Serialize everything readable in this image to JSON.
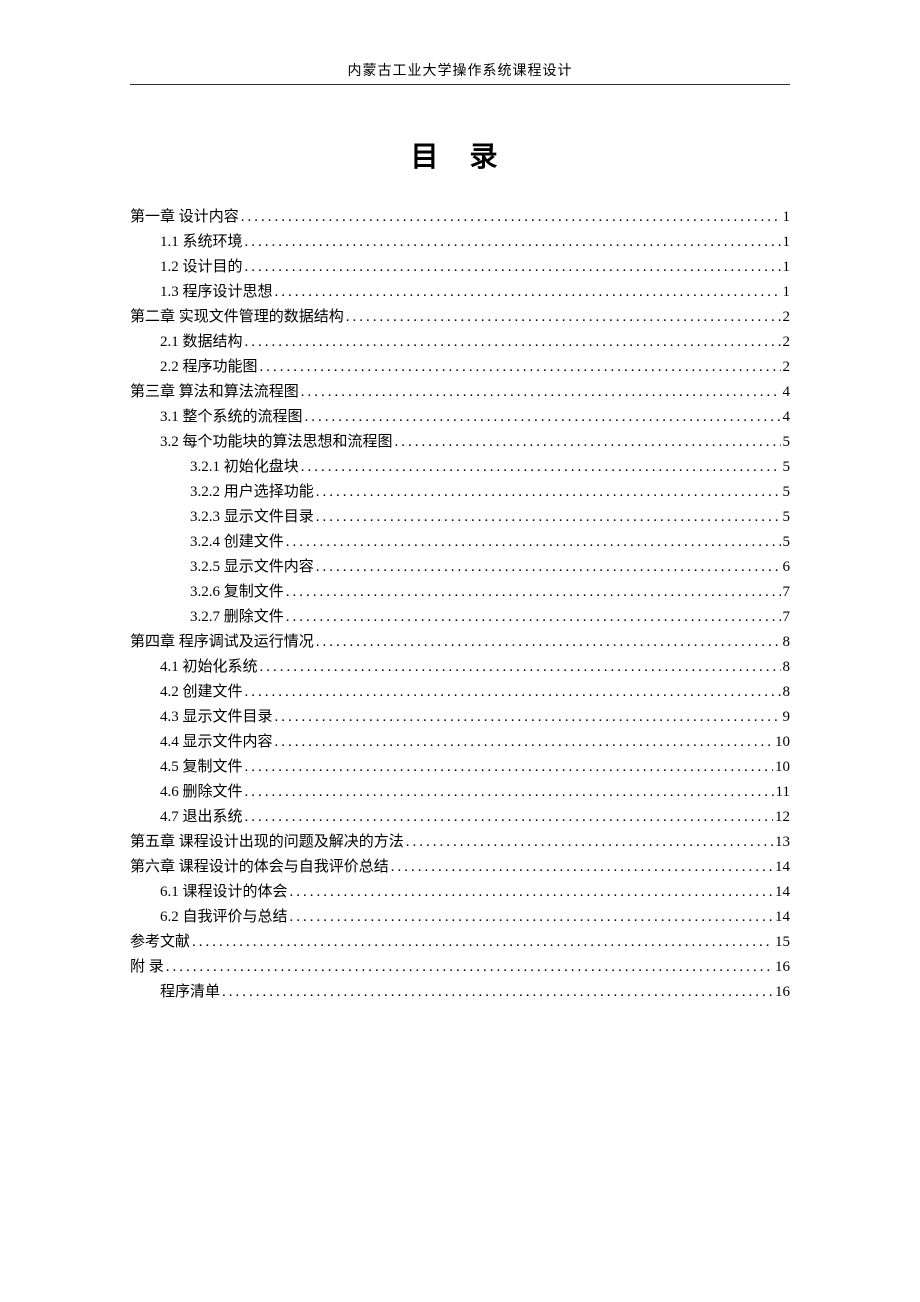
{
  "header": "内蒙古工业大学操作系统课程设计",
  "title": "目 录",
  "toc": [
    {
      "level": 0,
      "label": "第一章 设计内容",
      "page": "1"
    },
    {
      "level": 1,
      "label": "1.1 系统环境",
      "page": "1"
    },
    {
      "level": 1,
      "label": "1.2 设计目的",
      "page": "1"
    },
    {
      "level": 1,
      "label": "1.3 程序设计思想",
      "page": "1"
    },
    {
      "level": 0,
      "label": "第二章 实现文件管理的数据结构",
      "page": "2"
    },
    {
      "level": 1,
      "label": "2.1 数据结构",
      "page": "2"
    },
    {
      "level": 1,
      "label": "2.2 程序功能图",
      "page": "2"
    },
    {
      "level": 0,
      "label": "第三章 算法和算法流程图",
      "page": "4"
    },
    {
      "level": 1,
      "label": "3.1 整个系统的流程图",
      "page": "4"
    },
    {
      "level": 1,
      "label": "3.2 每个功能块的算法思想和流程图",
      "page": "5"
    },
    {
      "level": 2,
      "label": "3.2.1 初始化盘块",
      "page": "5"
    },
    {
      "level": 2,
      "label": "3.2.2 用户选择功能",
      "page": "5"
    },
    {
      "level": 2,
      "label": "3.2.3 显示文件目录",
      "page": "5"
    },
    {
      "level": 2,
      "label": "3.2.4 创建文件",
      "page": "5"
    },
    {
      "level": 2,
      "label": "3.2.5 显示文件内容",
      "page": "6"
    },
    {
      "level": 2,
      "label": "3.2.6 复制文件",
      "page": "7"
    },
    {
      "level": 2,
      "label": "3.2.7 删除文件",
      "page": "7"
    },
    {
      "level": 0,
      "label": "第四章 程序调试及运行情况",
      "page": "8"
    },
    {
      "level": 1,
      "label": "4.1 初始化系统",
      "page": "8"
    },
    {
      "level": 1,
      "label": "4.2 创建文件",
      "page": "8"
    },
    {
      "level": 1,
      "label": "4.3 显示文件目录",
      "page": "9"
    },
    {
      "level": 1,
      "label": "4.4 显示文件内容",
      "page": "10"
    },
    {
      "level": 1,
      "label": "4.5 复制文件",
      "page": "10"
    },
    {
      "level": 1,
      "label": "4.6 删除文件",
      "page": "11"
    },
    {
      "level": 1,
      "label": "4.7 退出系统",
      "page": "12"
    },
    {
      "level": 0,
      "label": "第五章 课程设计出现的问题及解决的方法",
      "page": "13"
    },
    {
      "level": 0,
      "label": "第六章 课程设计的体会与自我评价总结",
      "page": "14"
    },
    {
      "level": 1,
      "label": "6.1 课程设计的体会",
      "page": "14"
    },
    {
      "level": 1,
      "label": "6.2 自我评价与总结",
      "page": "14"
    },
    {
      "level": 0,
      "label": "参考文献",
      "page": "15"
    },
    {
      "level": 0,
      "label": "附 录",
      "page": "16"
    },
    {
      "level": 1,
      "label": "程序清单",
      "page": "16"
    }
  ]
}
